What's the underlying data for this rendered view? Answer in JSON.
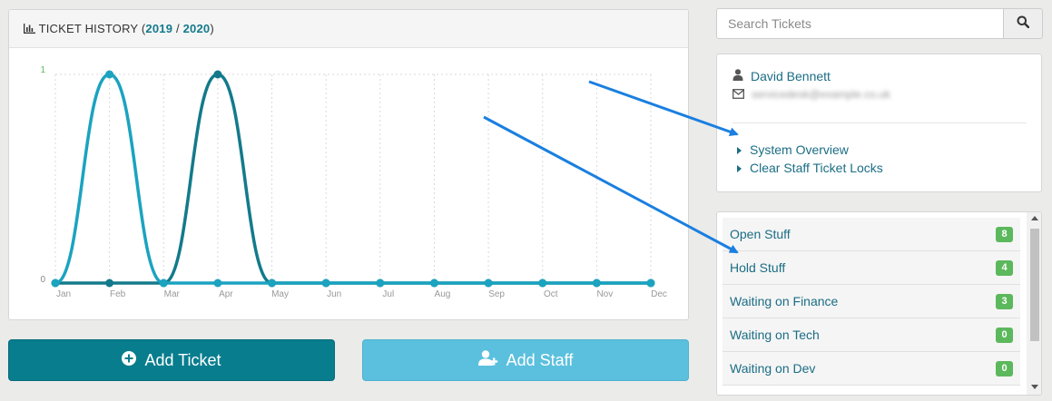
{
  "chart_panel": {
    "title_prefix": "TICKET HISTORY (",
    "year_a": "2019",
    "separator": " / ",
    "year_b": "2020",
    "title_suffix": ")",
    "icon": "bar-chart-icon"
  },
  "chart_data": {
    "type": "line",
    "categories": [
      "Jan",
      "Feb",
      "Mar",
      "Apr",
      "May",
      "Jun",
      "Jul",
      "Aug",
      "Sep",
      "Oct",
      "Nov",
      "Dec"
    ],
    "series": [
      {
        "values": [
          0,
          1,
          0,
          0,
          0,
          0,
          0,
          0,
          0,
          0,
          0,
          0
        ],
        "color": "#1ba3c0"
      },
      {
        "values": [
          0,
          0,
          0,
          1,
          0,
          0,
          0,
          0,
          0,
          0,
          0,
          0
        ],
        "color": "#137a8b"
      }
    ],
    "yticks": [
      "1",
      "0"
    ],
    "ylim": [
      0,
      1
    ],
    "grid": "dotted"
  },
  "buttons": {
    "add_ticket": "Add Ticket",
    "add_staff": "Add Staff"
  },
  "search": {
    "placeholder": "Search Tickets",
    "icon": "search-icon"
  },
  "user": {
    "name": "David Bennett",
    "email": "servicedesk@example.co.uk",
    "actions": [
      "System Overview",
      "Clear Staff Ticket Locks"
    ]
  },
  "statuses": [
    {
      "label": "Open Stuff",
      "count": "8"
    },
    {
      "label": "Hold Stuff",
      "count": "4"
    },
    {
      "label": "Waiting on Finance",
      "count": "3"
    },
    {
      "label": "Waiting on Tech",
      "count": "0"
    },
    {
      "label": "Waiting on Dev",
      "count": "0"
    }
  ],
  "colors": {
    "accent": "#087d8e",
    "secondary": "#5bc0de",
    "badge": "#5cb85c",
    "annotation_arrow": "#1a7fe0"
  }
}
